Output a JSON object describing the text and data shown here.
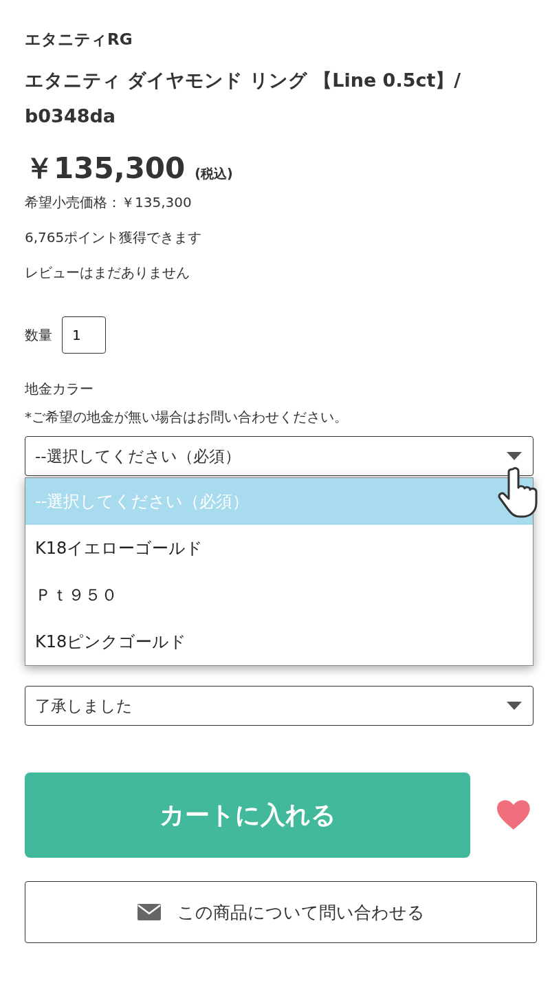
{
  "brand": "エタニティRG",
  "title": "エタニティ ダイヤモンド リング 【Line 0.5ct】/ b0348da",
  "price": {
    "amount": "￥135,300",
    "tax_note": "(税込)"
  },
  "retail_price": "希望小売価格：￥135,300",
  "points": "6,765ポイント獲得できます",
  "review": "レビューはまだありません",
  "quantity": {
    "label": "数量",
    "value": "1"
  },
  "options": [
    {
      "label": "地金カラー",
      "note": "*ご希望の地金が無い場合はお問い合わせください。",
      "select": {
        "value": "--選択してください（必須）",
        "expanded": true,
        "choices": [
          {
            "label": "--選択してください（必須）",
            "selected": true
          },
          {
            "label": "K18イエローゴールド",
            "selected": false
          },
          {
            "label": "Ｐｔ９５０",
            "selected": false
          },
          {
            "label": "K18ピンクゴールド",
            "selected": false
          }
        ]
      }
    },
    {
      "select": {
        "value": "了承しました",
        "expanded": false
      }
    }
  ],
  "cart_button": "カートに入れる",
  "inquiry_button": "この商品について問い合わせる"
}
